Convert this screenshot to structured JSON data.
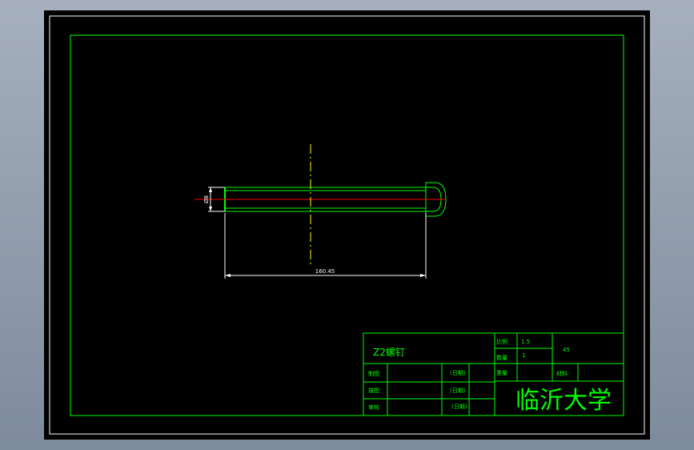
{
  "colors": {
    "frame": "#00ff00",
    "dimension": "#ffffff",
    "axis": "#ff0000",
    "centerline": "#ffff00",
    "text": "#00ff00"
  },
  "dimensions": {
    "diameter": "Ø8",
    "length": "160.45"
  },
  "title_block": {
    "part_name": "Z2螺钉",
    "scale_label": "比例",
    "scale_value": "1.5",
    "quantity_label": "数量",
    "quantity_value": "1",
    "weight_label": "重量",
    "material_label": "材料",
    "material_value": "45",
    "designer_label": "制图",
    "drafter_label": "描图",
    "checker_label": "审核",
    "date_1": "(日期)",
    "date_2": "(日期)",
    "date_3": "(日期)",
    "school": "临沂大学"
  }
}
